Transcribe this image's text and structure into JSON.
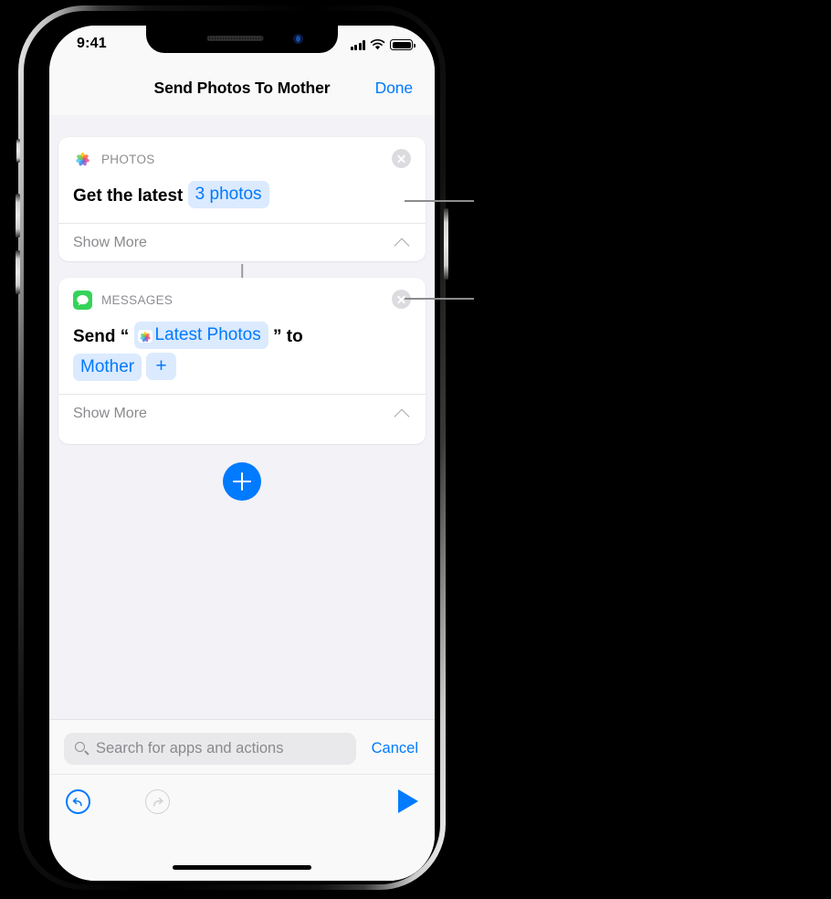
{
  "status_bar": {
    "time": "9:41",
    "signal_icon": "cellular-signal-icon",
    "wifi_icon": "wifi-icon",
    "battery_icon": "battery-icon"
  },
  "nav_bar": {
    "title": "Send Photos To Mother",
    "done_label": "Done"
  },
  "colors": {
    "accent": "#007aff",
    "token_background": "#dbeafe",
    "screen_background": "#f2f2f7",
    "card_background": "#ffffff",
    "secondary_text": "#8e8e93"
  },
  "cards": [
    {
      "app_name": "PHOTOS",
      "app_icon": "photos-app-icon",
      "close_icon": "close-circle-icon",
      "body": {
        "prefix": "Get the latest",
        "token": "3 photos"
      },
      "show_more_label": "Show More",
      "chevron_icon": "chevron-up-icon"
    },
    {
      "app_name": "MESSAGES",
      "app_icon": "messages-app-icon",
      "close_icon": "close-circle-icon",
      "body": {
        "prefix": "Send",
        "open_quote": "“",
        "token_icon": "photos-app-icon",
        "token": "Latest Photos",
        "close_quote": "”",
        "middle": "to",
        "recipient_token": "Mother",
        "add_recipient_label": "+"
      },
      "show_more_label": "Show More",
      "chevron_icon": "chevron-up-icon"
    }
  ],
  "add_action": {
    "icon": "plus-icon",
    "label": "+"
  },
  "search": {
    "icon": "search-icon",
    "placeholder": "Search for apps and actions",
    "value": "",
    "cancel_label": "Cancel"
  },
  "toolbar": {
    "undo_icon": "undo-icon",
    "redo_icon": "redo-icon",
    "play_icon": "play-icon",
    "home_indicator": "home-indicator"
  },
  "annotations": {
    "leader_line_1": "leader-line-photos-action",
    "leader_line_2": "leader-line-messages-action"
  }
}
